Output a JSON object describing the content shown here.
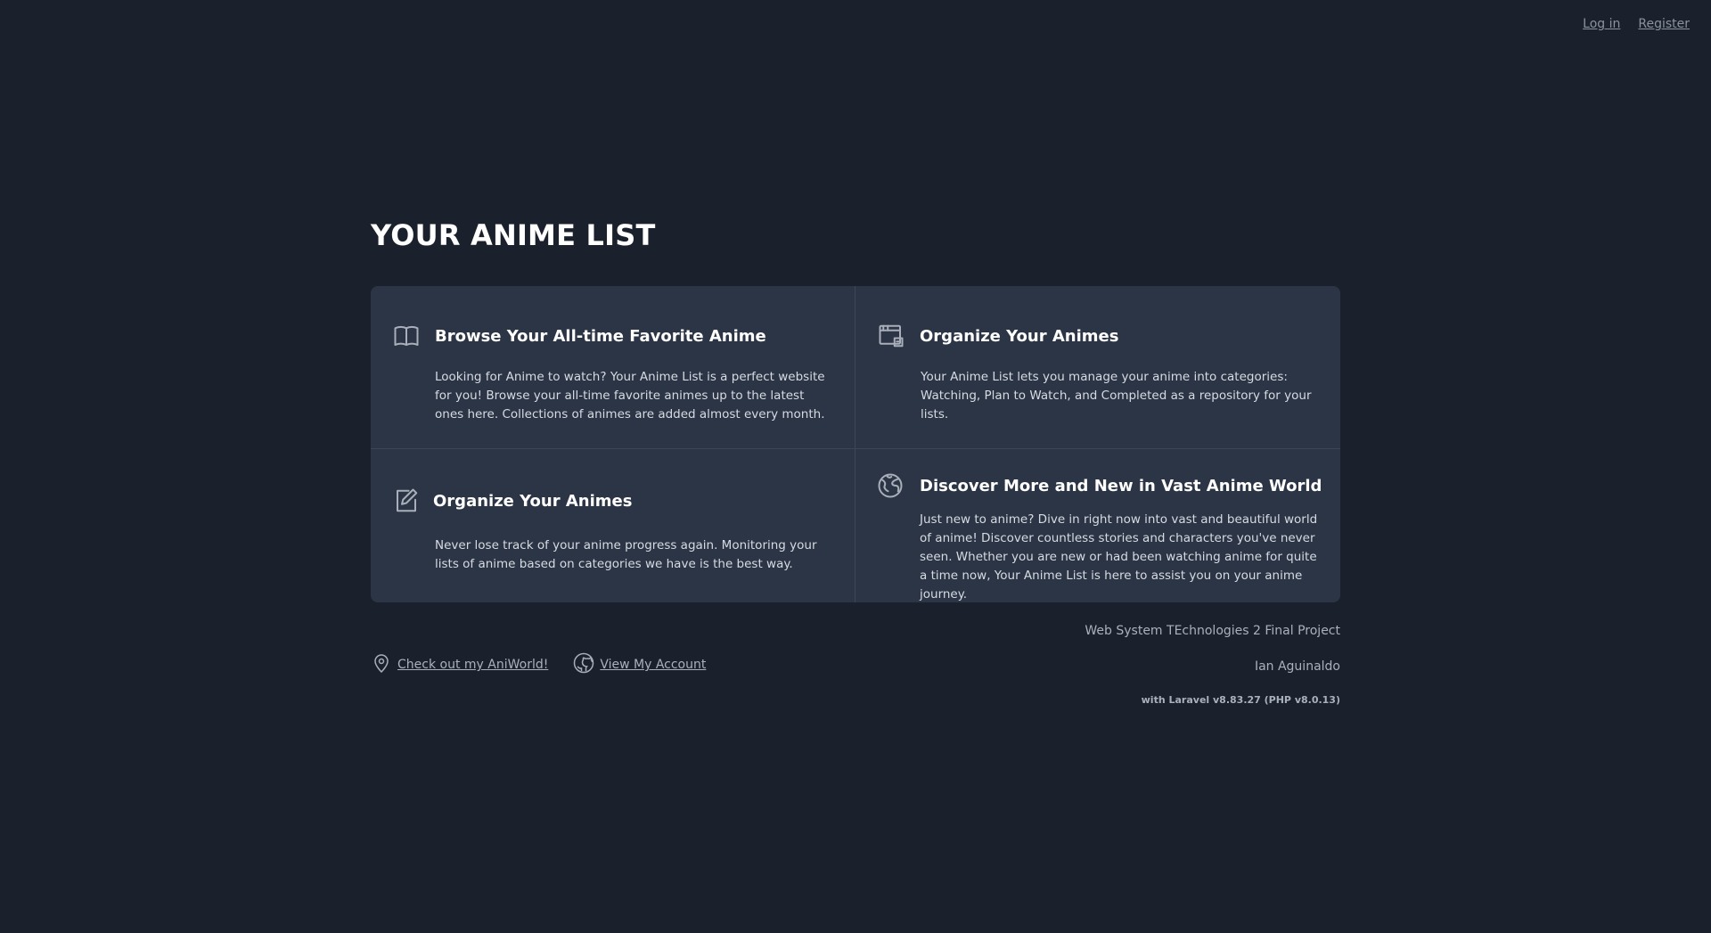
{
  "nav": {
    "login": "Log in",
    "register": "Register"
  },
  "page_title": "YOUR ANIME LIST",
  "cards": [
    {
      "icon": "book-open-icon",
      "title": "Browse Your All-time Favorite Anime",
      "body": "Looking for Anime to watch? Your Anime List is a perfect website for you! Browse your all-time favorite animes up to the latest ones here. Collections of animes are added almost every month."
    },
    {
      "icon": "screen-list-icon",
      "title": "Organize Your Animes",
      "body": "Your Anime List lets you manage your anime into categories: Watching, Plan to Watch, and Completed as a repository for your lists."
    },
    {
      "icon": "edit-note-icon",
      "title": "Organize Your Animes",
      "body": "Never lose track of your anime progress again. Monitoring your lists of anime based on categories we have is the best way."
    },
    {
      "icon": "globe-icon",
      "title": "Discover More and New in Vast Anime World",
      "body": "Just new to anime? Dive in right now into vast and beautiful world of anime! Discover countless stories and characters you've never seen. Whether you are new or had been watching anime for quite a time now, Your Anime List is here to assist you on your anime journey."
    }
  ],
  "footer": {
    "link1": "Check out my AniWorld!",
    "link2": "View My Account",
    "project": "Web System TEchnologies 2 Final Project",
    "author": "Ian Aguinaldo",
    "version": "with Laravel v8.83.27 (PHP v8.0.13)"
  }
}
